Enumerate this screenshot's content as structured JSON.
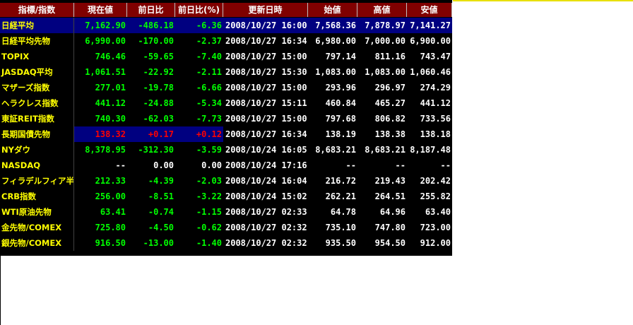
{
  "colors": {
    "header_bg": "#800000",
    "header_text": "#ffffff",
    "name_text": "#ffff00",
    "up": "#ff0000",
    "down": "#00ff00",
    "neutral": "#ffffff",
    "datetime": "#ffffff",
    "highlight_bg": "#000080"
  },
  "headers": [
    "指標/指数",
    "現在値",
    "前日比",
    "前日比(%)",
    "更新日時",
    "始値",
    "高値",
    "安値"
  ],
  "rows": [
    {
      "name": "日経平均",
      "current": "7,162.90",
      "change": "-486.18",
      "change_pct": "-6.36",
      "updated": "2008/10/27 16:00",
      "open": "7,568.36",
      "high": "7,878.97",
      "low": "7,141.27",
      "trend": "down",
      "highlight": "all"
    },
    {
      "name": "日経平均先物",
      "current": "6,990.00",
      "change": "-170.00",
      "change_pct": "-2.37",
      "updated": "2008/10/27 16:34",
      "open": "6,980.00",
      "high": "7,000.00",
      "low": "6,900.00",
      "trend": "down",
      "highlight": "none"
    },
    {
      "name": "TOPIX",
      "current": "746.46",
      "change": "-59.65",
      "change_pct": "-7.40",
      "updated": "2008/10/27 15:00",
      "open": "797.14",
      "high": "811.16",
      "low": "743.47",
      "trend": "down",
      "highlight": "none"
    },
    {
      "name": "JASDAQ平均",
      "current": "1,061.51",
      "change": "-22.92",
      "change_pct": "-2.11",
      "updated": "2008/10/27 15:30",
      "open": "1,083.00",
      "high": "1,083.00",
      "low": "1,060.46",
      "trend": "down",
      "highlight": "none"
    },
    {
      "name": "マザーズ指数",
      "current": "277.01",
      "change": "-19.78",
      "change_pct": "-6.66",
      "updated": "2008/10/27 15:00",
      "open": "293.96",
      "high": "296.97",
      "low": "274.29",
      "trend": "down",
      "highlight": "none"
    },
    {
      "name": "ヘラクレス指数",
      "current": "441.12",
      "change": "-24.88",
      "change_pct": "-5.34",
      "updated": "2008/10/27 15:11",
      "open": "460.84",
      "high": "465.27",
      "low": "441.12",
      "trend": "down",
      "highlight": "none"
    },
    {
      "name": "東証REIT指数",
      "current": "740.30",
      "change": "-62.03",
      "change_pct": "-7.73",
      "updated": "2008/10/27 15:00",
      "open": "797.68",
      "high": "806.82",
      "low": "733.56",
      "trend": "down",
      "highlight": "none"
    },
    {
      "name": "長期国債先物",
      "current": "138.32",
      "change": "+0.17",
      "change_pct": "+0.12",
      "updated": "2008/10/27 16:34",
      "open": "138.19",
      "high": "138.38",
      "low": "138.18",
      "trend": "up",
      "highlight": "values"
    },
    {
      "name": "NYダウ",
      "current": "8,378.95",
      "change": "-312.30",
      "change_pct": "-3.59",
      "updated": "2008/10/24 16:05",
      "open": "8,683.21",
      "high": "8,683.21",
      "low": "8,187.48",
      "trend": "down",
      "highlight": "none"
    },
    {
      "name": "NASDAQ",
      "current": "--",
      "change": "0.00",
      "change_pct": "0.00",
      "updated": "2008/10/24 17:16",
      "open": "--",
      "high": "--",
      "low": "--",
      "trend": "flat",
      "highlight": "none"
    },
    {
      "name": "フィラデルフィア半導",
      "current": "212.33",
      "change": "-4.39",
      "change_pct": "-2.03",
      "updated": "2008/10/24 16:04",
      "open": "216.72",
      "high": "219.43",
      "low": "202.42",
      "trend": "down",
      "highlight": "none"
    },
    {
      "name": "CRB指数",
      "current": "256.00",
      "change": "-8.51",
      "change_pct": "-3.22",
      "updated": "2008/10/24 15:02",
      "open": "262.21",
      "high": "264.51",
      "low": "255.82",
      "trend": "down",
      "highlight": "none"
    },
    {
      "name": "WTI原油先物",
      "current": "63.41",
      "change": "-0.74",
      "change_pct": "-1.15",
      "updated": "2008/10/27 02:33",
      "open": "64.78",
      "high": "64.96",
      "low": "63.40",
      "trend": "down",
      "highlight": "none"
    },
    {
      "name": "金先物/COMEX",
      "current": "725.80",
      "change": "-4.50",
      "change_pct": "-0.62",
      "updated": "2008/10/27 02:32",
      "open": "735.10",
      "high": "747.80",
      "low": "723.00",
      "trend": "down",
      "highlight": "none"
    },
    {
      "name": "銀先物/COMEX",
      "current": "916.50",
      "change": "-13.00",
      "change_pct": "-1.40",
      "updated": "2008/10/27 02:32",
      "open": "935.50",
      "high": "954.50",
      "low": "912.00",
      "trend": "down",
      "highlight": "none"
    }
  ]
}
